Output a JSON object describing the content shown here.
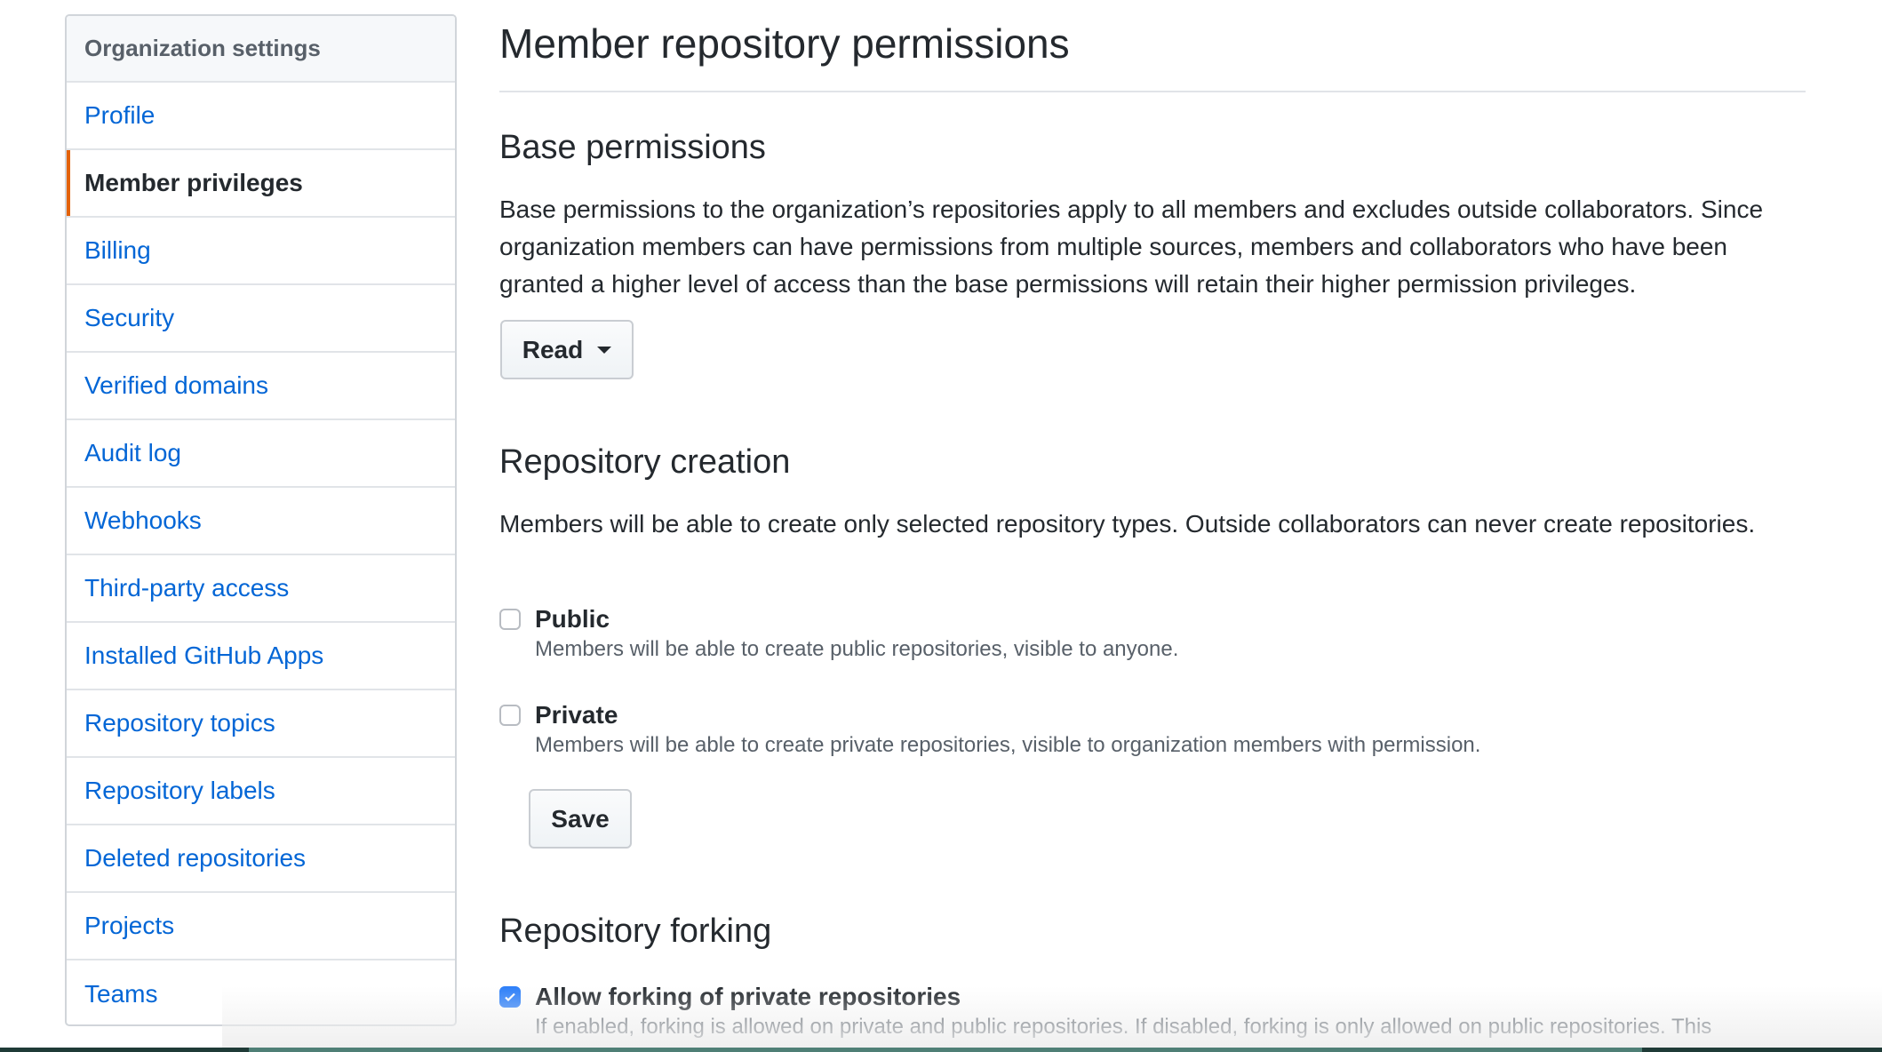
{
  "sidebar": {
    "header": "Organization settings",
    "items": [
      {
        "label": "Profile",
        "active": false
      },
      {
        "label": "Member privileges",
        "active": true
      },
      {
        "label": "Billing",
        "active": false
      },
      {
        "label": "Security",
        "active": false
      },
      {
        "label": "Verified domains",
        "active": false
      },
      {
        "label": "Audit log",
        "active": false
      },
      {
        "label": "Webhooks",
        "active": false
      },
      {
        "label": "Third-party access",
        "active": false
      },
      {
        "label": "Installed GitHub Apps",
        "active": false
      },
      {
        "label": "Repository topics",
        "active": false
      },
      {
        "label": "Repository labels",
        "active": false
      },
      {
        "label": "Deleted repositories",
        "active": false
      },
      {
        "label": "Projects",
        "active": false
      },
      {
        "label": "Teams",
        "active": false
      }
    ]
  },
  "main": {
    "title": "Member repository permissions",
    "base_permissions": {
      "title": "Base permissions",
      "description": "Base permissions to the organization’s repositories apply to all members and excludes outside collaborators. Since organization members can have permissions from multiple sources, members and collaborators who have been granted a higher level of access than the base permissions will retain their higher permission privileges.",
      "dropdown_value": "Read"
    },
    "repository_creation": {
      "title": "Repository creation",
      "description": "Members will be able to create only selected repository types. Outside collaborators can never create repositories.",
      "options": [
        {
          "label": "Public",
          "checked": false,
          "note": "Members will be able to create public repositories, visible to anyone."
        },
        {
          "label": "Private",
          "checked": false,
          "note": "Members will be able to create private repositories, visible to organization members with permission."
        }
      ],
      "save_label": "Save"
    },
    "repository_forking": {
      "title": "Repository forking",
      "option": {
        "label": "Allow forking of private repositories",
        "checked": true,
        "note": "If enabled, forking is allowed on private and public repositories. If disabled, forking is only allowed on public repositories. This"
      }
    }
  },
  "colors": {
    "link": "#0366d6",
    "active_indicator": "#e36209",
    "checkbox_checked": "#2d7ff9",
    "text_primary": "#24292e",
    "text_muted": "#586069"
  }
}
